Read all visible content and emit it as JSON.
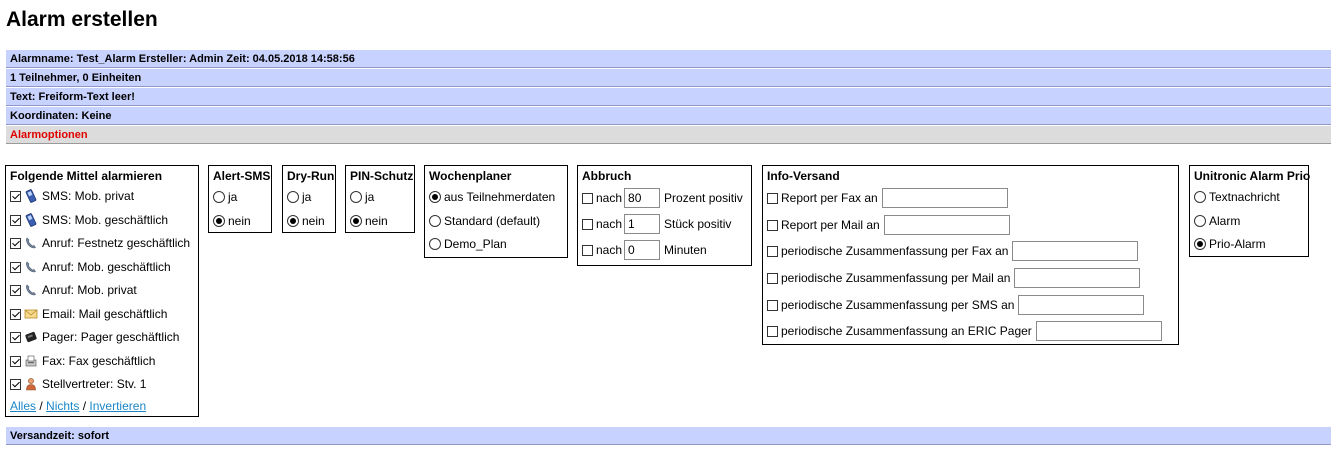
{
  "page": {
    "title": "Alarm erstellen"
  },
  "info_bars": {
    "alarm_line": "Alarmname: Test_Alarm Ersteller: Admin Zeit: 04.05.2018 14:58:56",
    "participants": "1 Teilnehmer, 0 Einheiten",
    "text": "Text: Freiform-Text leer!",
    "coordinates": "Koordinaten: Keine",
    "options": "Alarmoptionen",
    "send_time": "Versandzeit: sofort"
  },
  "mittel": {
    "title": "Folgende Mittel alarmieren",
    "items": [
      {
        "label": "SMS: Mob. privat",
        "icon": "mobile-phone-icon",
        "checked": true
      },
      {
        "label": "SMS: Mob. geschäftlich",
        "icon": "mobile-phone-icon",
        "checked": true
      },
      {
        "label": "Anruf: Festnetz geschäftlich",
        "icon": "phone-handset-icon",
        "checked": true
      },
      {
        "label": "Anruf: Mob. geschäftlich",
        "icon": "phone-handset-icon",
        "checked": true
      },
      {
        "label": "Anruf: Mob. privat",
        "icon": "phone-handset-icon",
        "checked": true
      },
      {
        "label": "Email: Mail geschäftlich",
        "icon": "envelope-icon",
        "checked": true
      },
      {
        "label": "Pager: Pager geschäftlich",
        "icon": "pager-icon",
        "checked": true
      },
      {
        "label": "Fax: Fax geschäftlich",
        "icon": "fax-icon",
        "checked": true
      },
      {
        "label": "Stellvertreter: Stv. 1",
        "icon": "person-icon",
        "checked": true
      }
    ],
    "link_all": "Alles",
    "link_none": "Nichts",
    "link_invert": "Invertieren",
    "separator": "/"
  },
  "alert_sms": {
    "title": "Alert-SMS",
    "yes": "ja",
    "no": "nein",
    "selected": "nein"
  },
  "dry_run": {
    "title": "Dry-Run",
    "yes": "ja",
    "no": "nein",
    "selected": "nein"
  },
  "pin_schutz": {
    "title": "PIN-Schutz",
    "yes": "ja",
    "no": "nein",
    "selected": "nein"
  },
  "wochenplaner": {
    "title": "Wochenplaner",
    "options": [
      "aus Teilnehmerdaten",
      "Standard (default)",
      "Demo_Plan"
    ],
    "selected": "aus Teilnehmerdaten"
  },
  "abbruch": {
    "title": "Abbruch",
    "rows": [
      {
        "prefix": "nach",
        "value": "80",
        "suffix": "Prozent positiv"
      },
      {
        "prefix": "nach",
        "value": "1",
        "suffix": "Stück positiv"
      },
      {
        "prefix": "nach",
        "value": "0",
        "suffix": "Minuten"
      }
    ]
  },
  "info_versand": {
    "title": "Info-Versand",
    "rows": [
      {
        "label": "Report per Fax an",
        "value": ""
      },
      {
        "label": "Report per Mail an",
        "value": ""
      },
      {
        "label": "periodische Zusammenfassung per Fax an",
        "value": ""
      },
      {
        "label": "periodische Zusammenfassung per Mail an",
        "value": ""
      },
      {
        "label": "periodische Zusammenfassung per SMS an",
        "value": ""
      },
      {
        "label": "periodische Zusammenfassung an ERIC Pager",
        "value": ""
      }
    ]
  },
  "prio": {
    "title": "Unitronic Alarm Prio",
    "options": [
      "Textnachricht",
      "Alarm",
      "Prio-Alarm"
    ],
    "selected": "Prio-Alarm"
  },
  "colors": {
    "bar_blue": "#c8d2ff",
    "bar_grey": "#dcdcdc",
    "options_red": "#e00000",
    "link_blue": "#1a86c8"
  }
}
